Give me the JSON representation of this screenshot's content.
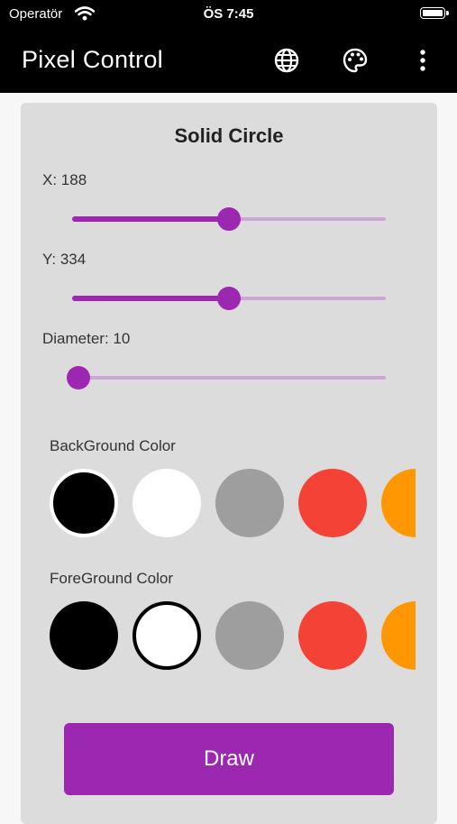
{
  "status_bar": {
    "carrier": "Operatör",
    "time": "ÖS 7:45"
  },
  "app_bar": {
    "title": "Pixel Control",
    "icons": [
      "globe-icon",
      "palette-icon",
      "more-vert-icon"
    ]
  },
  "card": {
    "title": "Solid Circle",
    "sliders": [
      {
        "label": "X: 188",
        "value": 188,
        "fraction": 0.5
      },
      {
        "label": "Y: 334",
        "value": 334,
        "fraction": 0.5
      },
      {
        "label": "Diameter: 10",
        "value": 10,
        "fraction": 0.02
      }
    ],
    "background_color": {
      "label": "BackGround Color",
      "swatches": [
        "#000000",
        "#ffffff",
        "#9e9e9e",
        "#f44336",
        "#ff9800"
      ],
      "selected_index": 0
    },
    "foreground_color": {
      "label": "ForeGround Color",
      "swatches": [
        "#000000",
        "#ffffff",
        "#9e9e9e",
        "#f44336",
        "#ff9800"
      ],
      "selected_index": 1
    },
    "draw_label": "Draw"
  },
  "colors": {
    "accent": "#9c27b0",
    "card": "#dcdcdc",
    "app_bar": "#000000"
  }
}
